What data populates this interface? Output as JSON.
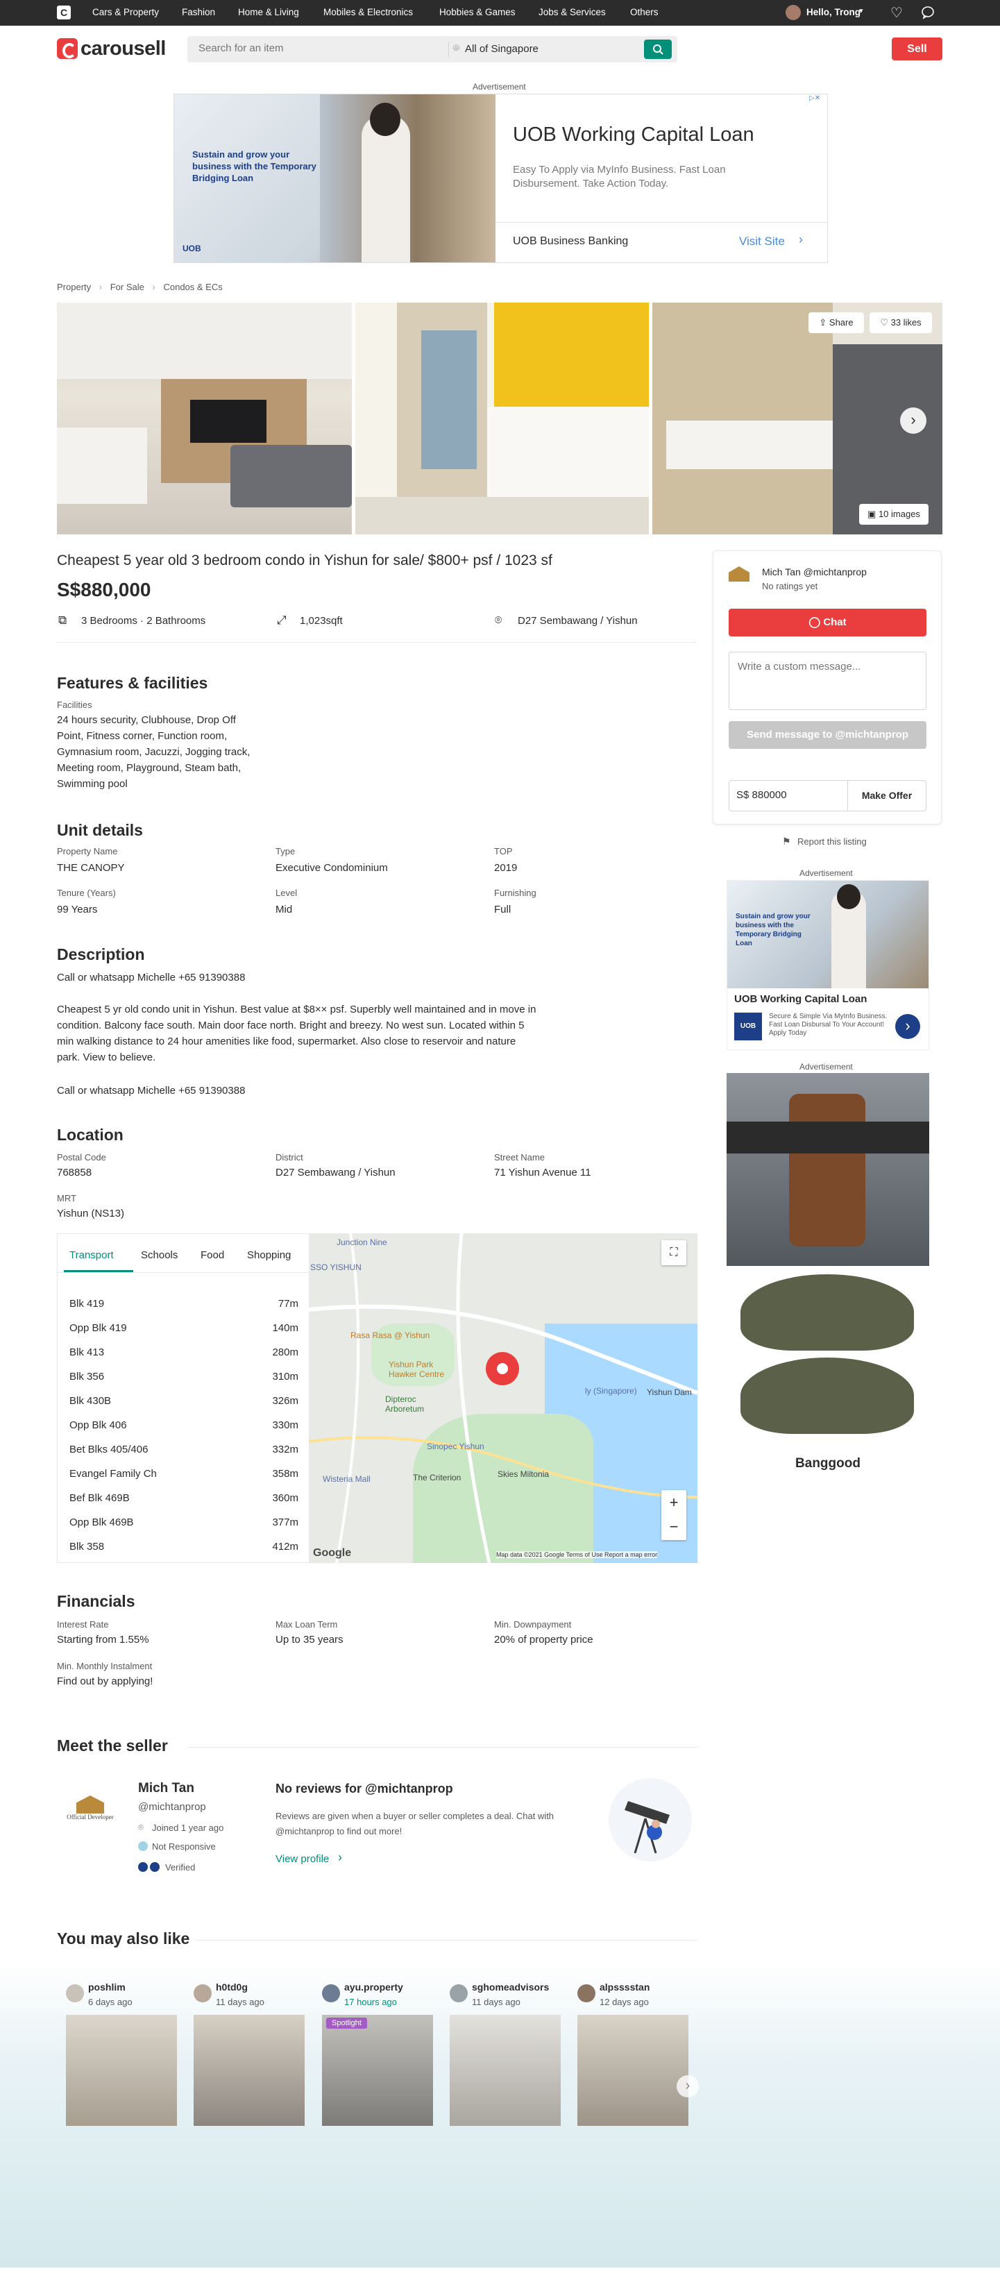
{
  "topnav": {
    "logo": "C",
    "categories": [
      "Cars & Property",
      "Fashion",
      "Home & Living",
      "Mobiles & Electronics",
      "Hobbies & Games",
      "Jobs & Services",
      "Others"
    ],
    "greeting": "Hello, Trong"
  },
  "header": {
    "brand": "carousell",
    "search_placeholder": "Search for an item",
    "location": "All of Singapore",
    "sell_label": "Sell"
  },
  "top_ad": {
    "label": "Advertisement",
    "image_text": "Sustain and grow your business with the Temporary Bridging Loan",
    "image_brand": "UOB",
    "title": "UOB Working Capital Loan",
    "body": "Easy To Apply via MyInfo Business. Fast Loan Disbursement. Take Action Today.",
    "advertiser": "UOB Business Banking",
    "cta": "Visit Site"
  },
  "breadcrumb": [
    "Property",
    "For Sale",
    "Condos & ECs"
  ],
  "gallery": {
    "share_label": "Share",
    "likes_label": "33 likes",
    "images_label": "10 images"
  },
  "listing": {
    "title": "Cheapest 5 year old 3 bedroom condo in Yishun for sale/ $800+ psf / 1023 sf",
    "price": "S$880,000",
    "rooms": "3 Bedrooms · 2 Bathrooms",
    "size": "1,023sqft",
    "district": "D27 Sembawang / Yishun"
  },
  "features": {
    "heading": "Features & facilities",
    "label": "Facilities",
    "text": "24 hours security, Clubhouse, Drop Off Point, Fitness corner, Function room, Gymnasium room, Jacuzzi, Jogging track, Meeting room, Playground, Steam bath, Swimming pool"
  },
  "unit": {
    "heading": "Unit details",
    "fields": [
      {
        "label": "Property Name",
        "value": "THE CANOPY"
      },
      {
        "label": "Type",
        "value": "Executive Condominium"
      },
      {
        "label": "TOP",
        "value": "2019"
      },
      {
        "label": "Tenure (Years)",
        "value": "99 Years"
      },
      {
        "label": "Level",
        "value": "Mid"
      },
      {
        "label": "Furnishing",
        "value": "Full"
      }
    ]
  },
  "description": {
    "heading": "Description",
    "line1": "Call or whatsapp Michelle +65 91390388",
    "para1": "Cheapest 5 yr old condo unit in Yishun. Best value at $8×× psf. Superbly well maintained and in move in",
    "para2": "condition.  Balcony face south. Main door face north. Bright and breezy. No west sun. Located within 5",
    "para3": "min walking distance to 24 hour amenities like food, supermarket. Also close to reservoir and nature",
    "para4": "park. View to believe.",
    "line2": "Call or whatsapp Michelle +65 91390388"
  },
  "location": {
    "heading": "Location",
    "fields": [
      {
        "label": "Postal Code",
        "value": "768858"
      },
      {
        "label": "District",
        "value": "D27 Sembawang / Yishun"
      },
      {
        "label": "Street Name",
        "value": "71 Yishun Avenue 11"
      },
      {
        "label": "MRT",
        "value": "Yishun (NS13)"
      }
    ],
    "tabs": [
      "Transport",
      "Schools",
      "Food",
      "Shopping"
    ],
    "places": [
      {
        "name": "Blk 419",
        "dist": "77m"
      },
      {
        "name": "Opp Blk 419",
        "dist": "140m"
      },
      {
        "name": "Blk 413",
        "dist": "280m"
      },
      {
        "name": "Blk 356",
        "dist": "310m"
      },
      {
        "name": "Blk 430B",
        "dist": "326m"
      },
      {
        "name": "Opp Blk 406",
        "dist": "330m"
      },
      {
        "name": "Bet Blks 405/406",
        "dist": "332m"
      },
      {
        "name": "Evangel Family Ch",
        "dist": "358m"
      },
      {
        "name": "Bef Blk 469B",
        "dist": "360m"
      },
      {
        "name": "Opp Blk 469B",
        "dist": "377m"
      },
      {
        "name": "Blk 358",
        "dist": "412m"
      }
    ],
    "map_labels": {
      "junction": "Junction Nine",
      "ss": "SSO YISHUN",
      "rasa": "Rasa Rasa @ Yishun",
      "hawker": "Yishun Park Hawker Centre",
      "dipteroc": "Dipteroc Arboretum",
      "sinopec": "Sinopec Yishun",
      "criterion": "The Criterion",
      "skies": "Skies Miltonia",
      "wisteria": "Wisteria Mall",
      "yishun_dam": "Yishun Dam",
      "sg": "ly (Singapore)",
      "google": "Google",
      "footer": "Map data ©2021 Google   Terms of Use   Report a map error"
    }
  },
  "financials": {
    "heading": "Financials",
    "fields": [
      {
        "label": "Interest Rate",
        "value": "Starting from 1.55%"
      },
      {
        "label": "Max Loan Term",
        "value": "Up to 35 years"
      },
      {
        "label": "Min. Downpayment",
        "value": "20% of property price"
      },
      {
        "label": "Min. Monthly Instalment",
        "value": "Find out by applying!"
      }
    ]
  },
  "seller": {
    "heading": "Meet the seller",
    "name": "Mich Tan",
    "handle": "@michtanprop",
    "joined": "Joined 1 year ago",
    "responsive": "Not Responsive",
    "verified": "Verified",
    "logo_text": "Official Developer",
    "reviews_title": "No reviews for @michtanprop",
    "reviews_body1": "Reviews are given when a buyer or seller completes a deal. Chat with",
    "reviews_body2": "@michtanprop to find out more!",
    "view_profile": "View profile"
  },
  "sidebar": {
    "seller_name": "Mich Tan @michtanprop",
    "ratings": "No ratings yet",
    "chat": "Chat",
    "message_placeholder": "Write a custom message...",
    "send": "Send message to @michtanprop",
    "offer_value": "S$ 880000",
    "make_offer": "Make Offer",
    "report": "Report this listing",
    "ad_label": "Advertisement",
    "ad2_text": "Sustain and grow your business with the Temporary Bridging Loan",
    "ad2_title": "UOB Working Capital Loan",
    "ad2_body": "Secure & Simple Via MyInfo Business. Fast Loan Disbursal To Your Account! Apply Today",
    "ad2_brand": "UOB",
    "ad3_label": "Advertisement",
    "ad3_brand": "Banggood"
  },
  "also_like": {
    "heading": "You may also like",
    "cards": [
      {
        "name": "poshlim",
        "time": "6 days ago"
      },
      {
        "name": "h0td0g",
        "time": "11 days ago"
      },
      {
        "name": "ayu.property",
        "time": "17 hours ago",
        "badge": "Spotlight"
      },
      {
        "name": "sghomeadvisors",
        "time": "11 days ago"
      },
      {
        "name": "alpsssstan",
        "time": "12 days ago"
      }
    ]
  },
  "colors": {
    "brand": "#ea3e3e",
    "accent": "#008f79",
    "dark": "#2c2c2d"
  }
}
